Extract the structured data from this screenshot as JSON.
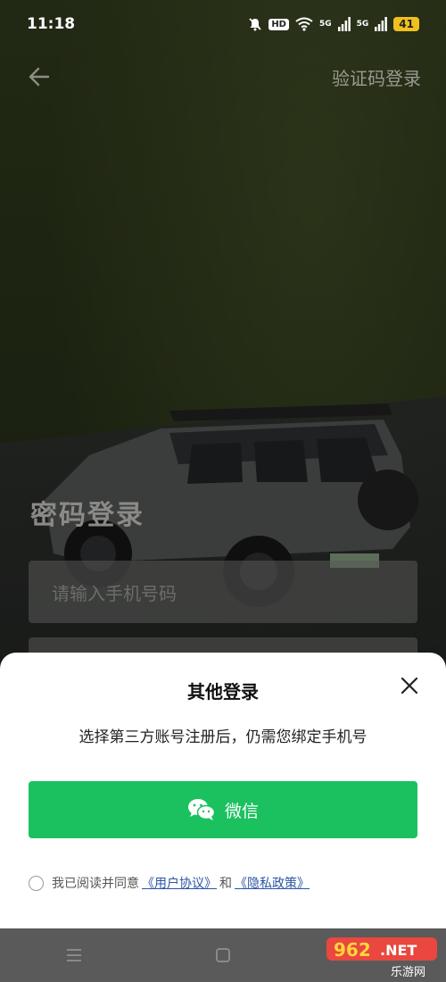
{
  "status_bar": {
    "time": "11:18",
    "hd": "HD",
    "sim1": "5G",
    "sim2": "5G",
    "battery": "41"
  },
  "header": {
    "right_link": "验证码登录"
  },
  "login_form": {
    "title": "密码登录",
    "phone_placeholder": "请输入手机号码"
  },
  "sheet": {
    "title": "其他登录",
    "subtitle": "选择第三方账号注册后，仍需您绑定手机号",
    "wechat_label": "微信",
    "agreement": {
      "prefix": "我已阅读并同意",
      "user_agreement": "《用户协议》",
      "conjunction": "和",
      "privacy_policy": "《隐私政策》"
    }
  },
  "watermark": {
    "brand": "962",
    "suffix": ".NET",
    "caption": "乐游网"
  },
  "colors": {
    "wechat_green": "#1bc15f",
    "link_blue": "#2a55a6",
    "battery_yellow": "#f0c020"
  },
  "icons": [
    "back-arrow-icon",
    "close-icon",
    "wechat-icon",
    "wifi-icon",
    "signal-icon",
    "mute-bell-icon",
    "menu-icon",
    "home-square-icon"
  ]
}
